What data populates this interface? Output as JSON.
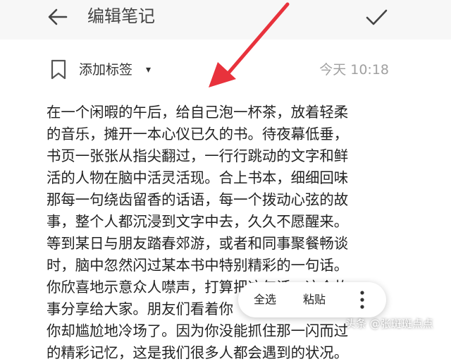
{
  "header": {
    "back_icon": "arrow-left-icon",
    "title": "编辑笔记",
    "confirm_icon": "check-icon"
  },
  "tag_bar": {
    "bookmark_icon": "bookmark-icon",
    "label": "添加标签",
    "caret": "▾",
    "timestamp": "今天 10:18"
  },
  "note": {
    "lines": [
      "在一个闲暇的午后，给自己泡一杯茶，放着轻柔",
      "的音乐，摊开一本心仪已久的书。待夜幕低垂，",
      "书页一张张从指尖翻过，一行行跳动的文字和鲜",
      "活的人物在脑中活灵活现。合上书本，细细回味",
      "那每一句绕齿留香的话语，每一个拨动心弦的故",
      "事，整个人都沉浸到文字中去，久久不愿醒来。",
      "等到某日与朋友踏春郊游，或者和同事聚餐畅谈",
      "时，脑中忽然闪过某本书中特别精彩的一句话。",
      "你欣喜地示意众人噤声，打算把这句话、这个故",
      "事分享给大家。朋友们看着你",
      "你却尴尬地冷场了。因为你没能抓住那一闪而过",
      "的精彩记忆，这是我们很多人都会遇到的状况。"
    ]
  },
  "context_menu": {
    "select_all": "全选",
    "paste": "粘贴",
    "more_icon": "more-vertical-icon"
  },
  "watermark": "头条 @张斑斑点点",
  "colors": {
    "header_bg": "#f7f7f7",
    "text": "#222222",
    "timestamp": "#a0a0a0",
    "annotation_arrow": "#e8323c"
  }
}
